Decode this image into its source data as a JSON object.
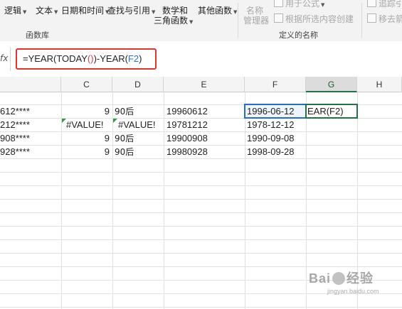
{
  "ribbon": {
    "logic": "逻辑",
    "text": "文本",
    "datetime": "日期和时间",
    "lookup": "查找与引用",
    "math_line1": "数学和",
    "math_line2": "三角函数",
    "other": "其他函数",
    "function_library": "函数库",
    "name_manager_line1": "名称",
    "name_manager_line2": "管理器",
    "use_in_formula": "用于公式",
    "create_from_selection": "根据所选内容创建",
    "defined_names": "定义的名称",
    "trace_precedents": "追踪引",
    "remove_arrows": "移去箭"
  },
  "formula_bar": {
    "fx_label": "fx",
    "formula_part1": "=YEAR(TODAY",
    "formula_parens": "()",
    "formula_part2": ")-YEAR(",
    "formula_ref": "F2",
    "formula_part3": ")"
  },
  "columns": [
    "C",
    "D",
    "E",
    "F",
    "G",
    "H"
  ],
  "rows": [
    {
      "b": "612****",
      "c": "9",
      "d": "90后",
      "e": "19960612",
      "f": "1996-06-12",
      "g": "EAR(F2)"
    },
    {
      "b": "212****",
      "c": "#VALUE!",
      "d": "#VALUE!",
      "e": "19781212",
      "f": "1978-12-12",
      "g": ""
    },
    {
      "b": "908****",
      "c": "9",
      "d": "90后",
      "e": "19900908",
      "f": "1990-09-08",
      "g": ""
    },
    {
      "b": "928****",
      "c": "9",
      "d": "90后",
      "e": "19980928",
      "f": "1998-09-28",
      "g": ""
    }
  ],
  "watermark": {
    "logo": "Bai",
    "logo_suffix": "经验",
    "url": "jingyan.baidu.com"
  }
}
